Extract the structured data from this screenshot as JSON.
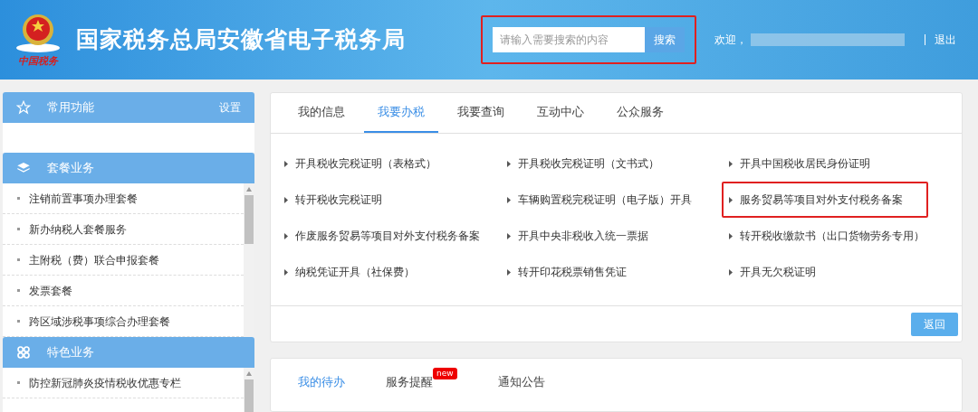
{
  "header": {
    "title": "国家税务总局安徽省电子税务局",
    "logo_caption": "中国税务",
    "search": {
      "placeholder": "请输入需要搜索的内容",
      "button": "搜索",
      "highlighted": true
    },
    "welcome": "欢迎，",
    "logout": "退出"
  },
  "sidebar": {
    "sections": [
      {
        "title": "常用功能",
        "action": "设置"
      },
      {
        "title": "套餐业务",
        "items": [
          "注销前置事项办理套餐",
          "新办纳税人套餐服务",
          "主附税（费）联合申报套餐",
          "发票套餐",
          "跨区域涉税事项综合办理套餐"
        ]
      },
      {
        "title": "特色业务",
        "items": [
          "防控新冠肺炎疫情税收优惠专栏"
        ]
      }
    ]
  },
  "main": {
    "tabs": [
      {
        "label": "我的信息",
        "selected": false
      },
      {
        "label": "我要办税",
        "selected": true
      },
      {
        "label": "我要查询",
        "selected": false
      },
      {
        "label": "互动中心",
        "selected": false
      },
      {
        "label": "公众服务",
        "selected": false
      }
    ],
    "links": [
      {
        "label": "开具税收完税证明（表格式）",
        "highlighted": false
      },
      {
        "label": "开具税收完税证明（文书式）",
        "highlighted": false
      },
      {
        "label": "开具中国税收居民身份证明",
        "highlighted": false
      },
      {
        "label": "转开税收完税证明",
        "highlighted": false
      },
      {
        "label": "车辆购置税完税证明（电子版）开具",
        "highlighted": false
      },
      {
        "label": "服务贸易等项目对外支付税务备案",
        "highlighted": true
      },
      {
        "label": "作废服务贸易等项目对外支付税务备案",
        "highlighted": false
      },
      {
        "label": "开具中央非税收入统一票据",
        "highlighted": false
      },
      {
        "label": "转开税收缴款书（出口货物劳务专用）",
        "highlighted": false
      },
      {
        "label": "纳税凭证开具（社保费）",
        "highlighted": false
      },
      {
        "label": "转开印花税票销售凭证",
        "highlighted": false
      },
      {
        "label": "开具无欠税证明",
        "highlighted": false
      }
    ],
    "back_button": "返回"
  },
  "bottom_panel": {
    "tabs": [
      {
        "label": "我的待办",
        "selected": true
      },
      {
        "label": "服务提醒",
        "selected": false,
        "badge": "new"
      },
      {
        "label": "通知公告",
        "selected": false
      }
    ]
  }
}
